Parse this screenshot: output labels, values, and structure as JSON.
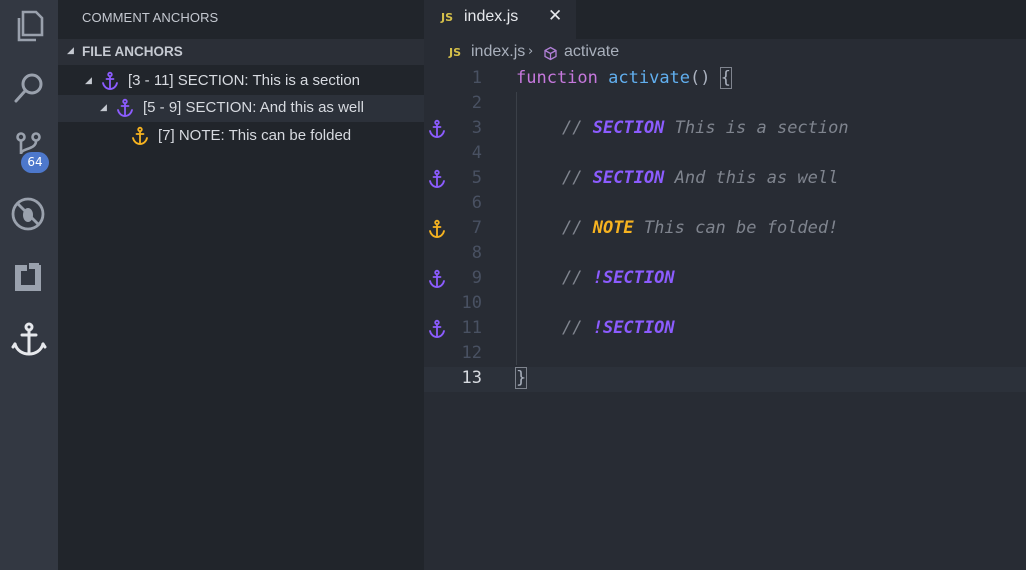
{
  "sidebar": {
    "title": "COMMENT ANCHORS",
    "section_header": "FILE ANCHORS",
    "items": [
      {
        "label": "[3 - 11] SECTION: This is a section",
        "tag": "section"
      },
      {
        "label": "[5 - 9] SECTION: And this as well",
        "tag": "section"
      },
      {
        "label": "[7] NOTE: This can be folded",
        "tag": "note"
      }
    ]
  },
  "activity_bar": {
    "icons": [
      "explorer-icon",
      "search-icon",
      "source-control-icon",
      "debug-icon",
      "extensions-icon",
      "anchor-icon"
    ],
    "scm_badge": "64"
  },
  "editor": {
    "tab": {
      "language_badge": "JS",
      "filename": "index.js",
      "close_glyph": "✕"
    },
    "breadcrumb": {
      "language_badge": "JS",
      "file": "index.js",
      "separator": "›",
      "symbol": "activate"
    },
    "lines": [
      {
        "number": "1"
      },
      {
        "number": "2"
      },
      {
        "number": "3",
        "comment": "// ",
        "tag": "SECTION",
        "text": " This is a section"
      },
      {
        "number": "4"
      },
      {
        "number": "5",
        "comment": "// ",
        "tag": "SECTION",
        "text": " And this as well"
      },
      {
        "number": "6"
      },
      {
        "number": "7",
        "comment": "// ",
        "tag": "NOTE",
        "text": " This can be folded!"
      },
      {
        "number": "8"
      },
      {
        "number": "9",
        "comment": "// ",
        "tag": "!SECTION"
      },
      {
        "number": "10"
      },
      {
        "number": "11",
        "comment": "// ",
        "tag": "!SECTION"
      },
      {
        "number": "12"
      },
      {
        "number": "13"
      }
    ],
    "code": {
      "keyword": "function",
      "function_name": "activate",
      "parens": "() ",
      "open_brace": "{",
      "close_brace": "}"
    }
  },
  "colors": {
    "section_tag": "#8c5cff",
    "note_tag": "#f7b320",
    "badge": "#4d78cc",
    "js_badge": "#d5c04a"
  }
}
